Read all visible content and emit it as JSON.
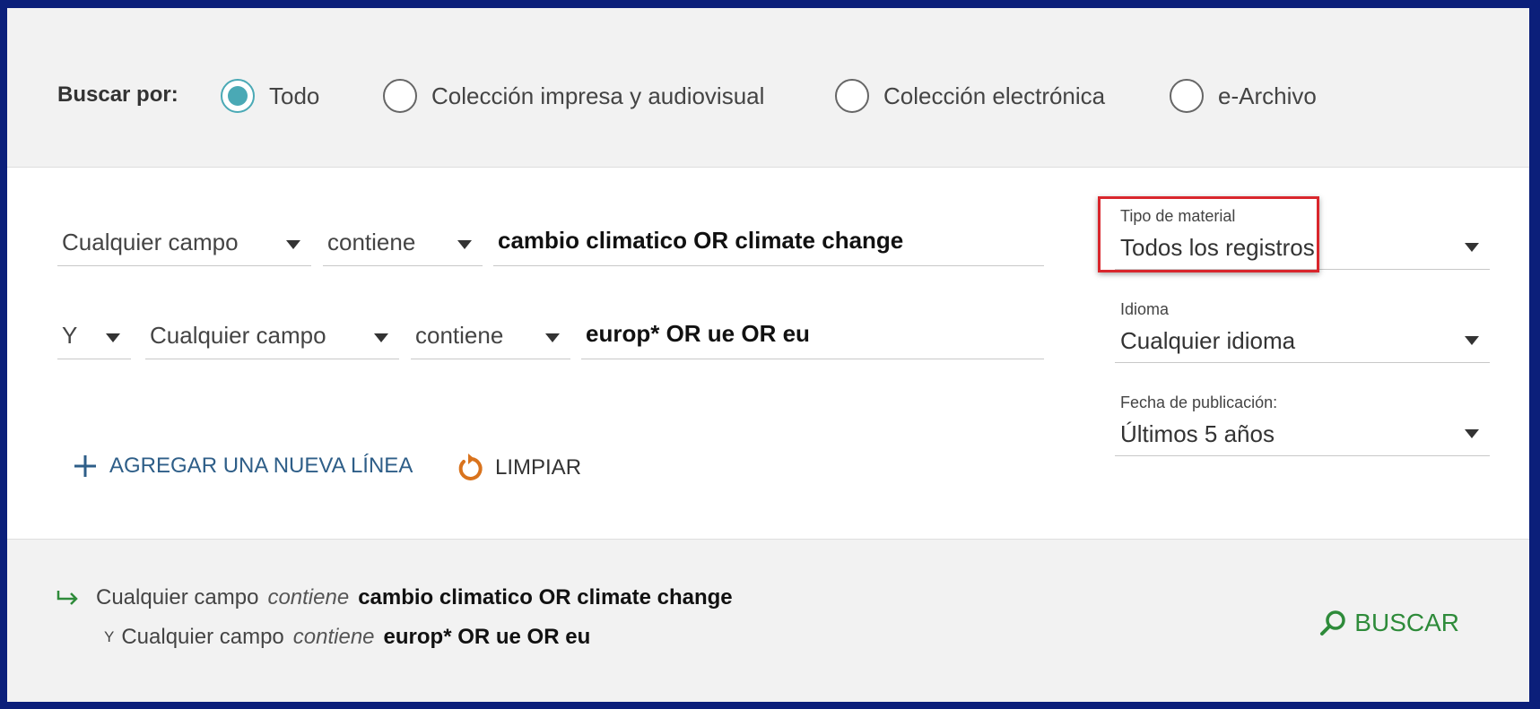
{
  "search_by": {
    "label": "Buscar por:",
    "options": [
      "Todo",
      "Colección impresa y audiovisual",
      "Colección electrónica",
      "e-Archivo"
    ],
    "selected": "Todo"
  },
  "query": {
    "line1": {
      "field": "Cualquier campo",
      "operator": "contiene",
      "value": "cambio climatico OR climate change"
    },
    "line2": {
      "boolean": "Y",
      "field": "Cualquier campo",
      "operator": "contiene",
      "value": "europ* OR ue OR eu"
    }
  },
  "filters": {
    "material": {
      "label": "Tipo de material",
      "value": "Todos los registros"
    },
    "language": {
      "label": "Idioma",
      "value": "Cualquier idioma"
    },
    "date": {
      "label": "Fecha de publicación:",
      "value": "Últimos 5 años"
    }
  },
  "actions": {
    "add_line": "AGREGAR UNA NUEVA LÍNEA",
    "clear": "LIMPIAR",
    "search": "BUSCAR"
  },
  "summary": {
    "line1": {
      "field": "Cualquier campo",
      "operator": "contiene",
      "value": "cambio climatico OR climate change"
    },
    "line2": {
      "boolean": "Y",
      "field": "Cualquier campo",
      "operator": "contiene",
      "value": "europ* OR ue OR eu"
    }
  },
  "icons": {
    "add": "plus-icon",
    "clear": "reset-icon",
    "search": "search-icon",
    "summary": "arrow-return-icon"
  },
  "colors": {
    "frame": "#0b1f7a",
    "radio_selected": "#4aa9b5",
    "highlight": "#d9262c",
    "search": "#2e8b3a",
    "add": "#2e5e88"
  }
}
